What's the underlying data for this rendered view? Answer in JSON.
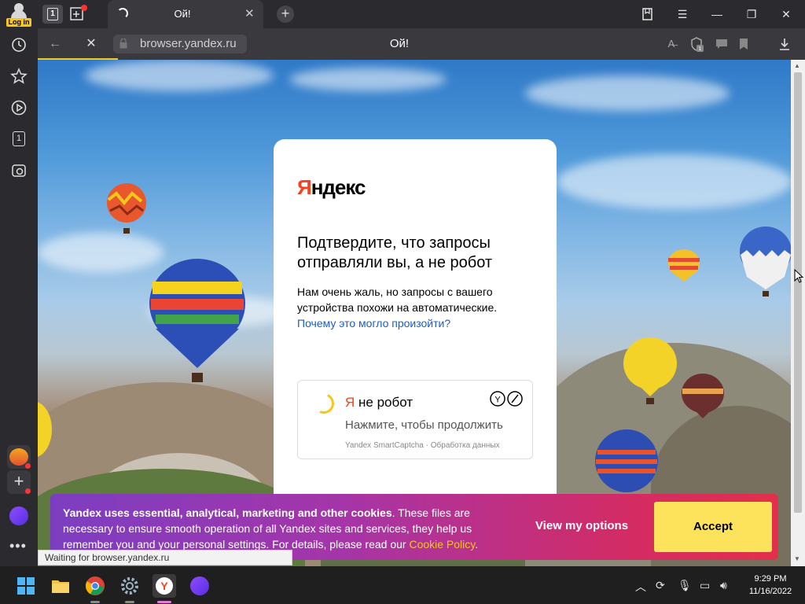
{
  "titlebar": {
    "login_label": "Log in",
    "tab_count": "1",
    "active_tab_title": "Ой!",
    "new_tab_icon": "plus-icon"
  },
  "navbar": {
    "url": "browser.yandex.ru",
    "page_title": "Ой!"
  },
  "sidebar": {
    "badge": "1",
    "more": "•••"
  },
  "card": {
    "logo": "Яндекс",
    "heading": "Подтвердите, что запросы отправляли вы, а не робот",
    "description": "Нам очень жаль, но запросы с вашего устройства похожи на автоматические.",
    "why_link": "Почему это могло произойти?",
    "captcha_title_ya": "Я",
    "captcha_title_rest": " не робот",
    "captcha_subtitle": "Нажмите, чтобы продолжить",
    "captcha_footer": "Yandex SmartCaptcha · Обработка данных"
  },
  "cookie": {
    "bold_text": "Yandex uses essential, analytical, marketing and other cookies",
    "body_text": ". These files are necessary to ensure smooth operation of all Yandex sites and services, they help us remember you and your personal settings. For details, please read our ",
    "policy_link": "Cookie Policy",
    "end": ".",
    "options_label": "View my options",
    "accept_label": "Accept"
  },
  "status_text": "Waiting for browser.yandex.ru",
  "taskbar": {
    "time": "9:29 PM",
    "date": "11/16/2022"
  },
  "colors": {
    "yandex_red": "#fc3f1d",
    "yandex_yellow": "#f6c61b",
    "link_blue": "#1a5dc9"
  }
}
